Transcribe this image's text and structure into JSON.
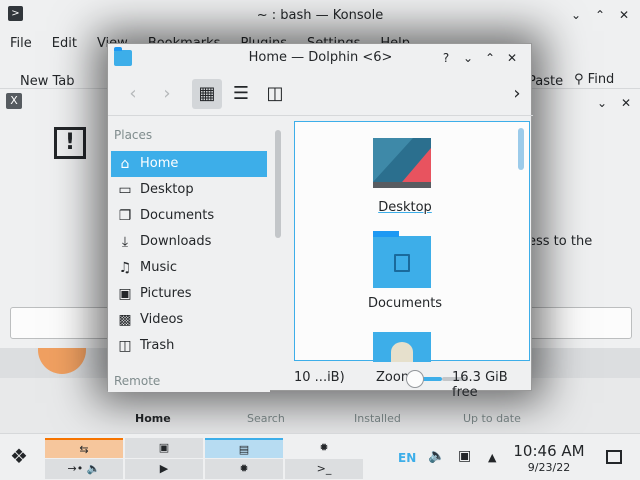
{
  "konsole": {
    "title": "~ : bash — Konsole",
    "menu": [
      "File",
      "Edit",
      "View",
      "Bookmarks",
      "Plugins",
      "Settings",
      "Help"
    ],
    "new_tab": "New Tab",
    "paste": "Paste",
    "find": "Find"
  },
  "dialog": {
    "message_fragment": "ess to the"
  },
  "discover": {
    "tabs": [
      "Home",
      "Search",
      "Installed",
      "Up to date"
    ]
  },
  "dolphin": {
    "title": "Home — Dolphin <6>",
    "places_header": "Places",
    "remote_header": "Remote",
    "places": [
      {
        "label": "Home",
        "icon": "home-icon"
      },
      {
        "label": "Desktop",
        "icon": "desktop-icon"
      },
      {
        "label": "Documents",
        "icon": "documents-icon"
      },
      {
        "label": "Downloads",
        "icon": "downloads-icon"
      },
      {
        "label": "Music",
        "icon": "music-icon"
      },
      {
        "label": "Pictures",
        "icon": "pictures-icon"
      },
      {
        "label": "Videos",
        "icon": "videos-icon"
      },
      {
        "label": "Trash",
        "icon": "trash-icon"
      }
    ],
    "files": [
      {
        "name": "Desktop",
        "icon": "wallpaper-icon"
      },
      {
        "name": "Documents",
        "icon": "folder-documents-icon"
      }
    ],
    "status": {
      "count": "10 ...iB)",
      "zoom_label": "Zoom:",
      "zoom_level": 0.3,
      "free_space": "16.3 GiB free"
    }
  },
  "panel": {
    "language": "EN",
    "time": "10:46 AM",
    "date": "9/23/22"
  },
  "colors": {
    "accent": "#3daee9",
    "window_bg": "#eff0f1",
    "view_bg": "#fcfcfc",
    "text": "#232629"
  }
}
